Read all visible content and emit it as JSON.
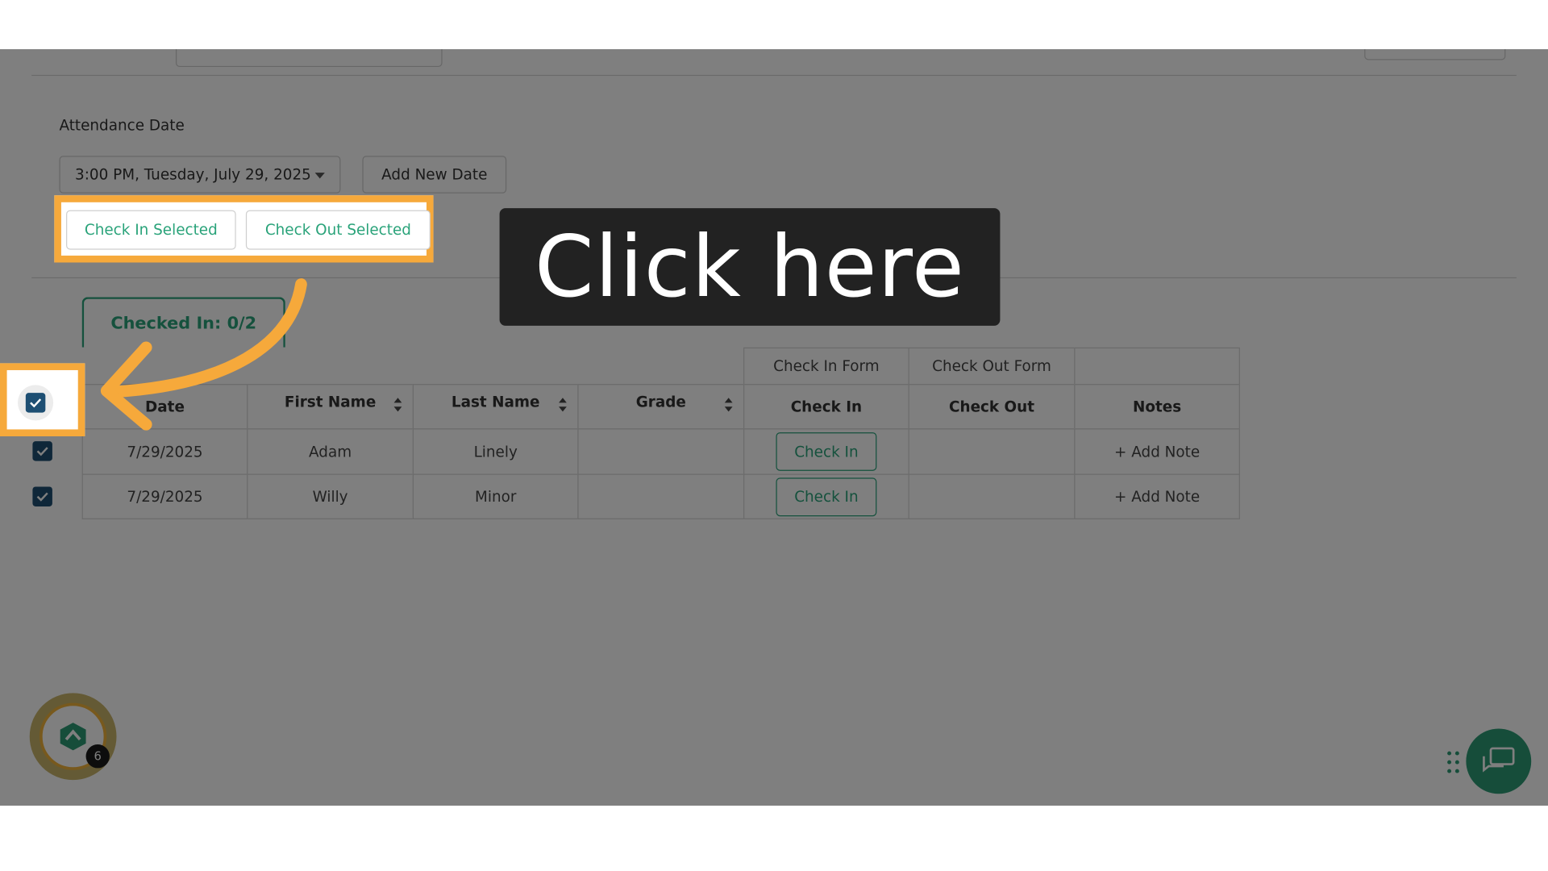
{
  "attendance": {
    "label": "Attendance Date",
    "selected_date": "3:00 PM, Tuesday, July 29, 2025",
    "add_new_date": "Add New Date",
    "check_in_selected": "Check In Selected",
    "check_out_selected": "Check Out Selected"
  },
  "summary": {
    "checked_in": "Checked In: 0/2"
  },
  "table": {
    "group_headers": [
      "Check In Form",
      "Check Out Form"
    ],
    "columns": [
      "Date",
      "First Name",
      "Last Name",
      "Grade",
      "Check In",
      "Check Out",
      "Notes"
    ],
    "rows": [
      {
        "date": "7/29/2025",
        "first": "Adam",
        "last": "Linely",
        "grade": "",
        "check_in": "Check In",
        "check_out": "",
        "notes": "+ Add Note"
      },
      {
        "date": "7/29/2025",
        "first": "Willy",
        "last": "Minor",
        "grade": "",
        "check_in": "Check In",
        "check_out": "",
        "notes": "+ Add Note"
      }
    ]
  },
  "callout": {
    "text": "Click here"
  },
  "badge": {
    "count": "6"
  },
  "colors": {
    "highlight": "#f6a93b",
    "accent": "#2aa37a",
    "checkbox": "#1e4f73"
  }
}
